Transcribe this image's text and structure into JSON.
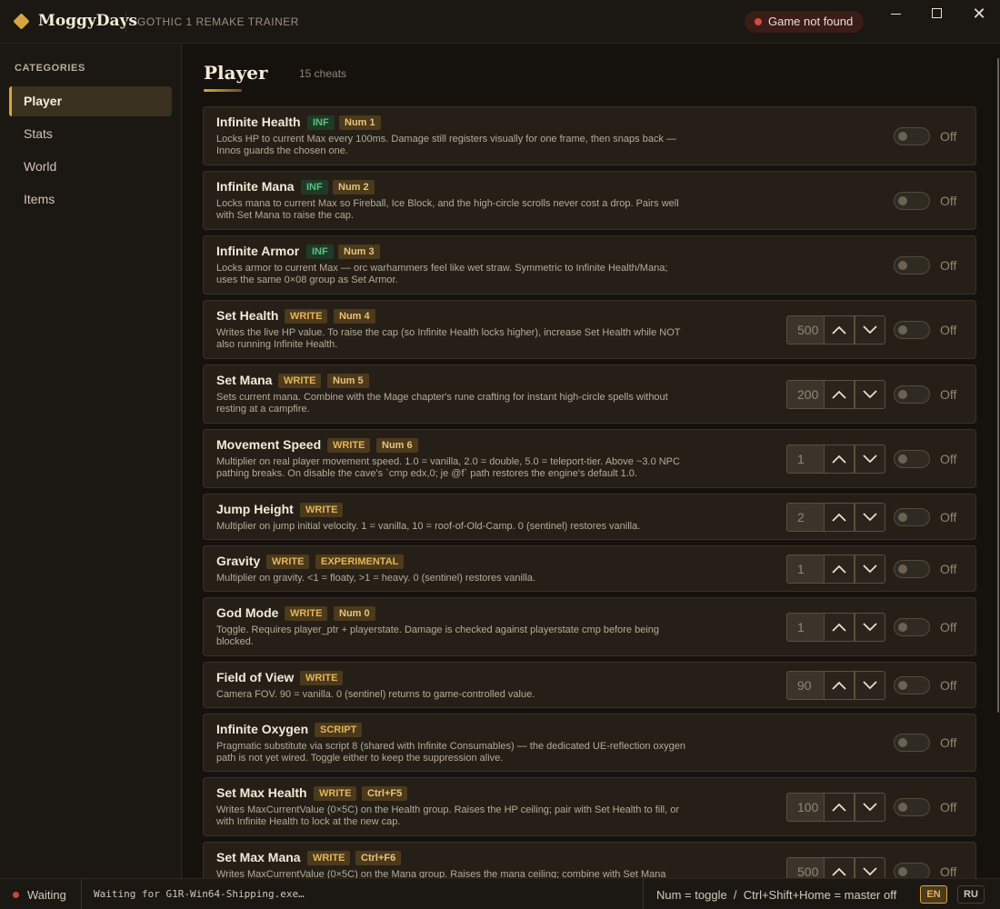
{
  "window": {
    "app_name": "MoggyDays",
    "subtitle": "GOTHIC 1 REMAKE TRAINER",
    "game_status": "Game not found",
    "controls": {
      "minimize": "minimize-icon",
      "maximize": "maximize-icon",
      "close": "✕"
    }
  },
  "sidebar": {
    "heading": "CATEGORIES",
    "items": [
      {
        "label": "Player",
        "active": true
      },
      {
        "label": "Stats",
        "active": false
      },
      {
        "label": "World",
        "active": false
      },
      {
        "label": "Items",
        "active": false
      }
    ]
  },
  "main": {
    "title": "Player",
    "count": "15 cheats",
    "toggle_off_label": "Off",
    "cheats": [
      {
        "name": "Infinite Health",
        "tags": [
          "INF",
          "Num 1"
        ],
        "description": "Locks HP to current Max every 100ms. Damage still registers visually for one frame, then snaps back — Innos guards the chosen one.",
        "value": null,
        "state": "Off"
      },
      {
        "name": "Infinite Mana",
        "tags": [
          "INF",
          "Num 2"
        ],
        "description": "Locks mana to current Max so Fireball, Ice Block, and the high-circle scrolls never cost a drop. Pairs well with Set Mana to raise the cap.",
        "value": null,
        "state": "Off"
      },
      {
        "name": "Infinite Armor",
        "tags": [
          "INF",
          "Num 3"
        ],
        "description": "Locks armor to current Max — orc warhammers feel like wet straw. Symmetric to Infinite Health/Mana; uses the same 0×08 group as Set Armor.",
        "value": null,
        "state": "Off"
      },
      {
        "name": "Set Health",
        "tags": [
          "WRITE",
          "Num 4"
        ],
        "description": "Writes the live HP value. To raise the cap (so Infinite Health locks higher), increase Set Health while NOT also running Infinite Health.",
        "value": "500",
        "state": "Off"
      },
      {
        "name": "Set Mana",
        "tags": [
          "WRITE",
          "Num 5"
        ],
        "description": "Sets current mana. Combine with the Mage chapter's rune crafting for instant high-circle spells without resting at a campfire.",
        "value": "200",
        "state": "Off"
      },
      {
        "name": "Movement Speed",
        "tags": [
          "WRITE",
          "Num 6"
        ],
        "description": "Multiplier on real player movement speed. 1.0 = vanilla, 2.0 = double, 5.0 = teleport-tier. Above ~3.0 NPC pathing breaks. On disable the cave's `cmp edx,0; je @f` path restores the engine's default 1.0.",
        "value": "1",
        "state": "Off"
      },
      {
        "name": "Jump Height",
        "tags": [
          "WRITE"
        ],
        "description": "Multiplier on jump initial velocity. 1 = vanilla, 10 = roof-of-Old-Camp. 0 (sentinel) restores vanilla.",
        "value": "2",
        "state": "Off"
      },
      {
        "name": "Gravity",
        "tags": [
          "WRITE",
          "EXPERIMENTAL"
        ],
        "description": "Multiplier on gravity. <1 = floaty, >1 = heavy. 0 (sentinel) restores vanilla.",
        "value": "1",
        "state": "Off"
      },
      {
        "name": "God Mode",
        "tags": [
          "WRITE",
          "Num 0"
        ],
        "description": "Toggle. Requires player_ptr + playerstate. Damage is checked against playerstate cmp before being blocked.",
        "value": "1",
        "state": "Off"
      },
      {
        "name": "Field of View",
        "tags": [
          "WRITE"
        ],
        "description": "Camera FOV. 90 = vanilla. 0 (sentinel) returns to game-controlled value.",
        "value": "90",
        "state": "Off"
      },
      {
        "name": "Infinite Oxygen",
        "tags": [
          "SCRIPT"
        ],
        "description": "Pragmatic substitute via script 8 (shared with Infinite Consumables) — the dedicated UE-reflection oxygen path is not yet wired. Toggle either to keep the suppression alive.",
        "value": null,
        "state": "Off"
      },
      {
        "name": "Set Max Health",
        "tags": [
          "WRITE",
          "Ctrl+F5"
        ],
        "description": "Writes MaxCurrentValue (0×5C) on the Health group. Raises the HP ceiling; pair with Set Health to fill, or with Infinite Health to lock at the new cap.",
        "value": "100",
        "state": "Off"
      },
      {
        "name": "Set Max Mana",
        "tags": [
          "WRITE",
          "Ctrl+F6"
        ],
        "description": "Writes MaxCurrentValue (0×5C) on the Mana group. Raises the mana ceiling; combine with Set Mana",
        "value": "500",
        "state": "Off"
      }
    ]
  },
  "statusbar": {
    "state": "Waiting",
    "message": "Waiting for G1R-Win64-Shipping.exe…",
    "hint": "Num = toggle  /  Ctrl+Shift+Home = master off",
    "languages": [
      {
        "code": "EN",
        "active": true
      },
      {
        "code": "RU",
        "active": false
      }
    ]
  },
  "colors": {
    "accent": "#d9a441",
    "background": "#15120e",
    "card": "#261f17",
    "inf_tag": "#57c27a",
    "error_dot": "#d64a3c"
  }
}
